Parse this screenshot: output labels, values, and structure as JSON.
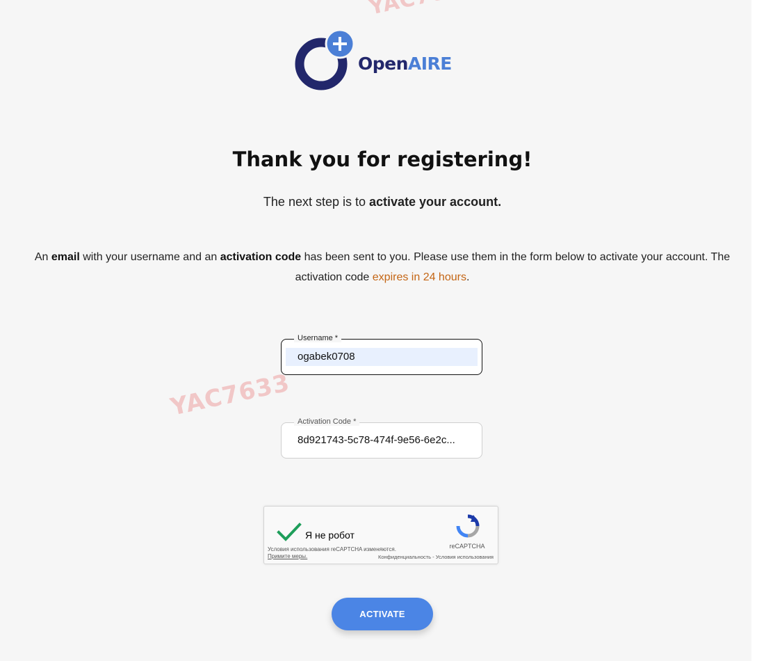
{
  "watermark": "YAC7633",
  "logo": {
    "text_open": "Open",
    "text_aire": "AIRE",
    "plus_symbol": "+"
  },
  "title": "Thank you for registering!",
  "subtitle": {
    "prefix": "The next step is to ",
    "bold": "activate your account."
  },
  "info": {
    "p1": "An ",
    "b1": "email",
    "p2": " with your username and an ",
    "b2": "activation code",
    "p3": " has been sent to you. Please use them in the form below to activate your account. The activation code ",
    "expire": "expires in 24 hours",
    "p4": "."
  },
  "form": {
    "username": {
      "label": "Username *",
      "value": "ogabek0708"
    },
    "activation_code": {
      "label": "Activation Code *",
      "value": "8d921743-5c78-474f-9e56-6e2c..."
    }
  },
  "captcha": {
    "label": "Я не робот",
    "terms_text": "Условия использования reCAPTCHA изменяются.",
    "terms_link": "Примите меры.",
    "brand": "reCAPTCHA",
    "links": "Конфиденциальность - Условия использования"
  },
  "actions": {
    "activate_label": "ACTIVATE"
  },
  "colors": {
    "accent": "#4b85e5",
    "logo_dark": "#22276b",
    "logo_light": "#4b7fd6",
    "expire": "#c46514"
  }
}
